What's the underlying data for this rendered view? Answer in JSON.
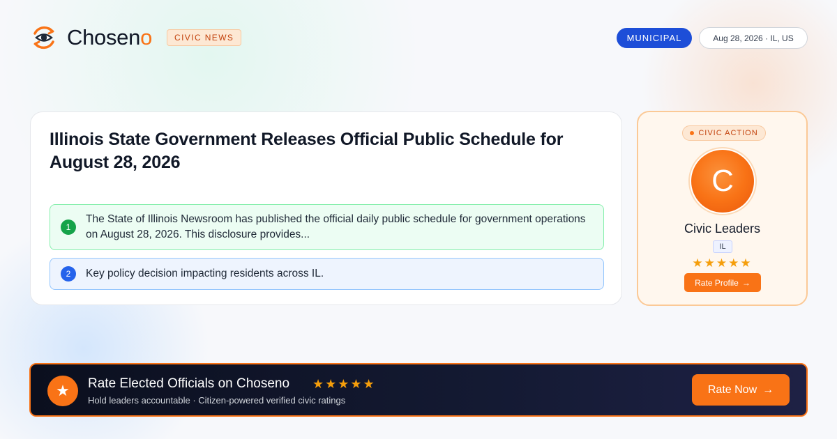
{
  "brand": {
    "name_main": "Chosen",
    "name_accent": "o",
    "tag": "CIVIC NEWS",
    "logo_icon": "eye-arrows-icon"
  },
  "header": {
    "category": "MUNICIPAL",
    "date_location": "Aug 28, 2026 · IL, US"
  },
  "article": {
    "title": "Illinois State Government Releases Official Public Schedule for August 28, 2026",
    "points": [
      {
        "num": "1",
        "text": "The State of Illinois Newsroom has published the official daily public schedule for government operations on August 28, 2026. This disclosure provides..."
      },
      {
        "num": "2",
        "text": "Key policy decision impacting residents across IL."
      }
    ]
  },
  "profile": {
    "tag": "CIVIC ACTION",
    "avatar_letter": "C",
    "name": "Civic Leaders",
    "state": "IL",
    "stars": "★★★★★",
    "button_label": "Rate Profile",
    "button_arrow": "→"
  },
  "banner": {
    "icon": "star-icon",
    "icon_glyph": "★",
    "title": "Rate Elected Officials on Choseno",
    "stars": "★★★★★",
    "subtitle": "Hold leaders accountable · Citizen-powered verified civic ratings",
    "button_label": "Rate Now",
    "button_arrow": "→"
  },
  "colors": {
    "accent": "#f97316",
    "primary_blue": "#1d4ed8",
    "success_green": "#16a34a",
    "star": "#f59e0b"
  }
}
